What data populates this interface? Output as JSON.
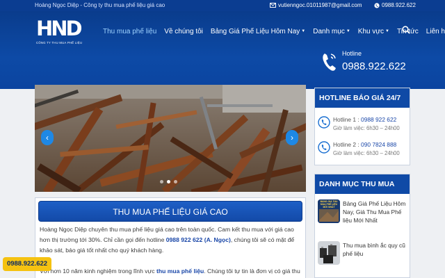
{
  "topbar": {
    "tagline": "Hoàng Ngọc Diệp - Công ty thu mua phế liệu giá cao",
    "email": "vutienngoc.01011987@gmail.com",
    "phone": "0988.922.622"
  },
  "logo": {
    "mark": "HND",
    "subtitle": "CÔNG TY THU MUA PHẾ LIỆU"
  },
  "nav": {
    "items": [
      {
        "label": "Thu mua phế liệu",
        "dropdown": false,
        "active": true
      },
      {
        "label": "Về chúng tôi",
        "dropdown": false,
        "active": false
      },
      {
        "label": "Bảng Giá Phế Liệu Hôm Nay",
        "dropdown": true,
        "active": false
      },
      {
        "label": "Danh mục",
        "dropdown": true,
        "active": false
      },
      {
        "label": "Khu vực",
        "dropdown": true,
        "active": false
      },
      {
        "label": "Tin tức",
        "dropdown": false,
        "active": false
      },
      {
        "label": "Liên hệ",
        "dropdown": false,
        "active": false
      }
    ]
  },
  "header_hotline": {
    "label": "Hotline",
    "number": "0988.922.622"
  },
  "slider": {
    "prev": "‹",
    "next": "›",
    "current_slide": 1,
    "total_slides": 3
  },
  "content": {
    "title": "THU MUA PHẾ LIỆU GIÁ CAO",
    "p1_a": "Hoàng Ngọc Diệp chuyên thu mua phế liệu giá cao trên toàn quốc. Cam kết thu mua với giá cao hơn thị trường tới 30%. Chỉ cần gọi đến hotline ",
    "p1_hotline": "0988 922 622 (A. Ngọc)",
    "p1_b": ", chúng tôi sẽ có mặt để khảo sát, báo giá tốt nhất cho quý khách hàng.",
    "p2_a": "Với hơn 10 năm kinh nghiệm trong lĩnh vực ",
    "p2_link": "thu mua phế liệu",
    "p2_b": ". Chúng tôi tự tin là đơn vị có giá thu mua cao"
  },
  "sidebar": {
    "hotline_box": {
      "title": "HOTLINE BÁO GIÁ 24/7",
      "rows": [
        {
          "label": "Hotline 1 : ",
          "number": "0988 922 622",
          "hours": "Giờ làm việc: 6h30 – 24h00"
        },
        {
          "label": "Hotline 2 : ",
          "number": "090 7824 888",
          "hours": "Giờ làm việc: 6h30 – 24h00"
        }
      ]
    },
    "category_box": {
      "title": "DANH MỤC THU MUA",
      "items": [
        {
          "caption": "Bảng Giá Phế Liệu Hôm Nay, Giá Thu Mua Phế liệu Mới Nhất",
          "thumb_text": "BẢNG GIÁ THU MUA PHẾ LIỆU MỚI NHẤT"
        },
        {
          "caption": "Thu mua bình ắc quy cũ phế liệu"
        }
      ]
    }
  },
  "float_phone": "0988.922.622",
  "colors": {
    "primary": "#0f4aa6",
    "topbar": "#0b3d91",
    "accent": "#f5c211",
    "link": "#1a47a8"
  }
}
